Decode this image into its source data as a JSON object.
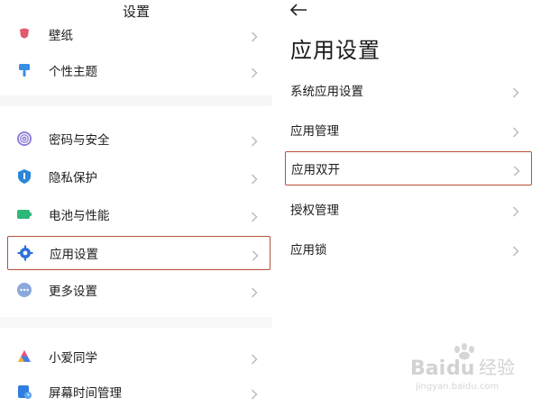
{
  "left": {
    "title": "设置",
    "items": [
      {
        "label": "壁纸",
        "icon": "wallpaper-icon"
      },
      {
        "label": "个性主题",
        "icon": "theme-brush-icon"
      },
      {
        "label": "密码与安全",
        "icon": "fingerprint-icon"
      },
      {
        "label": "隐私保护",
        "icon": "privacy-shield-icon"
      },
      {
        "label": "电池与性能",
        "icon": "battery-icon"
      },
      {
        "label": "应用设置",
        "icon": "gear-icon"
      },
      {
        "label": "更多设置",
        "icon": "more-dots-icon"
      },
      {
        "label": "小爱同学",
        "icon": "xiaoai-icon"
      },
      {
        "label": "屏幕时间管理",
        "icon": "screen-time-icon"
      }
    ]
  },
  "right": {
    "title": "应用设置",
    "items": [
      {
        "label": "系统应用设置"
      },
      {
        "label": "应用管理"
      },
      {
        "label": "应用双开"
      },
      {
        "label": "授权管理"
      },
      {
        "label": "应用锁"
      }
    ]
  },
  "watermark": {
    "brand_latin": "Bai",
    "brand_latin2": "du",
    "brand_cn": "经验",
    "url": "jingyan.baidu.com"
  },
  "colors": {
    "highlight": "#b5523a",
    "gear": "#2f6fe0",
    "battery": "#2db87a",
    "privacy": "#2b86d9",
    "theme": "#3a8ee6",
    "wallpaper": "#e25a6d"
  }
}
